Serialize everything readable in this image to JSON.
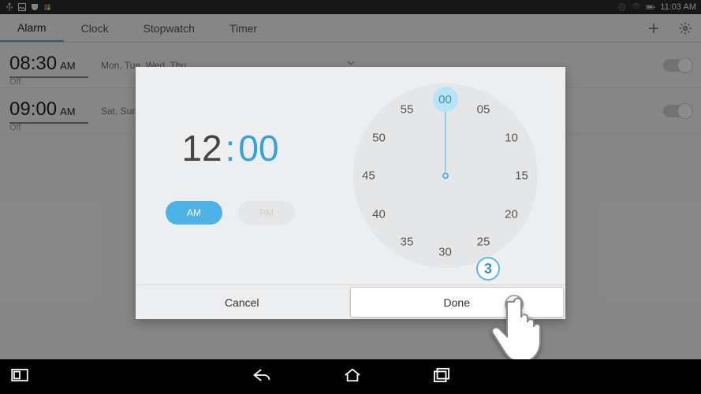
{
  "status": {
    "time": "11:03 AM"
  },
  "tabs": {
    "t0": "Alarm",
    "t1": "Clock",
    "t2": "Stopwatch",
    "t3": "Timer"
  },
  "alarms": [
    {
      "time": "08:30",
      "ampm": "AM",
      "days": "Mon, Tue, Wed, Thu...",
      "state": "Off"
    },
    {
      "time": "09:00",
      "ampm": "AM",
      "days": "Sat, Sun",
      "state": "Off"
    }
  ],
  "picker": {
    "hour": "12",
    "minute": "00",
    "am_label": "AM",
    "pm_label": "PM",
    "selected_period": "AM",
    "ticks": {
      "t00": "00",
      "t05": "05",
      "t10": "10",
      "t15": "15",
      "t20": "20",
      "t25": "25",
      "t30": "30",
      "t35": "35",
      "t40": "40",
      "t45": "45",
      "t50": "50",
      "t55": "55"
    },
    "cancel": "Cancel",
    "done": "Done"
  },
  "callout": {
    "label": "3"
  }
}
